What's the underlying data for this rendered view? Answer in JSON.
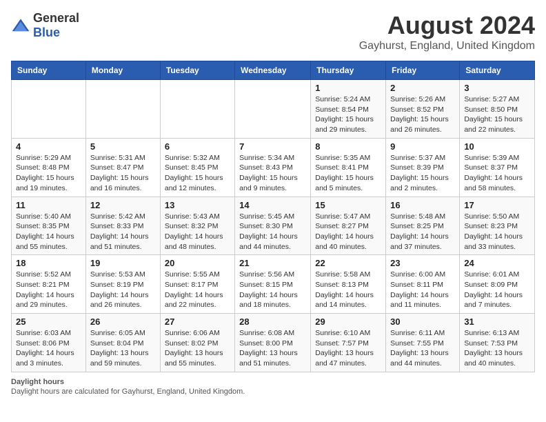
{
  "header": {
    "logo_general": "General",
    "logo_blue": "Blue",
    "title": "August 2024",
    "subtitle": "Gayhurst, England, United Kingdom"
  },
  "columns": [
    "Sunday",
    "Monday",
    "Tuesday",
    "Wednesday",
    "Thursday",
    "Friday",
    "Saturday"
  ],
  "weeks": [
    [
      {
        "day": "",
        "info": ""
      },
      {
        "day": "",
        "info": ""
      },
      {
        "day": "",
        "info": ""
      },
      {
        "day": "",
        "info": ""
      },
      {
        "day": "1",
        "info": "Sunrise: 5:24 AM\nSunset: 8:54 PM\nDaylight: 15 hours and 29 minutes."
      },
      {
        "day": "2",
        "info": "Sunrise: 5:26 AM\nSunset: 8:52 PM\nDaylight: 15 hours and 26 minutes."
      },
      {
        "day": "3",
        "info": "Sunrise: 5:27 AM\nSunset: 8:50 PM\nDaylight: 15 hours and 22 minutes."
      }
    ],
    [
      {
        "day": "4",
        "info": "Sunrise: 5:29 AM\nSunset: 8:48 PM\nDaylight: 15 hours and 19 minutes."
      },
      {
        "day": "5",
        "info": "Sunrise: 5:31 AM\nSunset: 8:47 PM\nDaylight: 15 hours and 16 minutes."
      },
      {
        "day": "6",
        "info": "Sunrise: 5:32 AM\nSunset: 8:45 PM\nDaylight: 15 hours and 12 minutes."
      },
      {
        "day": "7",
        "info": "Sunrise: 5:34 AM\nSunset: 8:43 PM\nDaylight: 15 hours and 9 minutes."
      },
      {
        "day": "8",
        "info": "Sunrise: 5:35 AM\nSunset: 8:41 PM\nDaylight: 15 hours and 5 minutes."
      },
      {
        "day": "9",
        "info": "Sunrise: 5:37 AM\nSunset: 8:39 PM\nDaylight: 15 hours and 2 minutes."
      },
      {
        "day": "10",
        "info": "Sunrise: 5:39 AM\nSunset: 8:37 PM\nDaylight: 14 hours and 58 minutes."
      }
    ],
    [
      {
        "day": "11",
        "info": "Sunrise: 5:40 AM\nSunset: 8:35 PM\nDaylight: 14 hours and 55 minutes."
      },
      {
        "day": "12",
        "info": "Sunrise: 5:42 AM\nSunset: 8:33 PM\nDaylight: 14 hours and 51 minutes."
      },
      {
        "day": "13",
        "info": "Sunrise: 5:43 AM\nSunset: 8:32 PM\nDaylight: 14 hours and 48 minutes."
      },
      {
        "day": "14",
        "info": "Sunrise: 5:45 AM\nSunset: 8:30 PM\nDaylight: 14 hours and 44 minutes."
      },
      {
        "day": "15",
        "info": "Sunrise: 5:47 AM\nSunset: 8:27 PM\nDaylight: 14 hours and 40 minutes."
      },
      {
        "day": "16",
        "info": "Sunrise: 5:48 AM\nSunset: 8:25 PM\nDaylight: 14 hours and 37 minutes."
      },
      {
        "day": "17",
        "info": "Sunrise: 5:50 AM\nSunset: 8:23 PM\nDaylight: 14 hours and 33 minutes."
      }
    ],
    [
      {
        "day": "18",
        "info": "Sunrise: 5:52 AM\nSunset: 8:21 PM\nDaylight: 14 hours and 29 minutes."
      },
      {
        "day": "19",
        "info": "Sunrise: 5:53 AM\nSunset: 8:19 PM\nDaylight: 14 hours and 26 minutes."
      },
      {
        "day": "20",
        "info": "Sunrise: 5:55 AM\nSunset: 8:17 PM\nDaylight: 14 hours and 22 minutes."
      },
      {
        "day": "21",
        "info": "Sunrise: 5:56 AM\nSunset: 8:15 PM\nDaylight: 14 hours and 18 minutes."
      },
      {
        "day": "22",
        "info": "Sunrise: 5:58 AM\nSunset: 8:13 PM\nDaylight: 14 hours and 14 minutes."
      },
      {
        "day": "23",
        "info": "Sunrise: 6:00 AM\nSunset: 8:11 PM\nDaylight: 14 hours and 11 minutes."
      },
      {
        "day": "24",
        "info": "Sunrise: 6:01 AM\nSunset: 8:09 PM\nDaylight: 14 hours and 7 minutes."
      }
    ],
    [
      {
        "day": "25",
        "info": "Sunrise: 6:03 AM\nSunset: 8:06 PM\nDaylight: 14 hours and 3 minutes."
      },
      {
        "day": "26",
        "info": "Sunrise: 6:05 AM\nSunset: 8:04 PM\nDaylight: 13 hours and 59 minutes."
      },
      {
        "day": "27",
        "info": "Sunrise: 6:06 AM\nSunset: 8:02 PM\nDaylight: 13 hours and 55 minutes."
      },
      {
        "day": "28",
        "info": "Sunrise: 6:08 AM\nSunset: 8:00 PM\nDaylight: 13 hours and 51 minutes."
      },
      {
        "day": "29",
        "info": "Sunrise: 6:10 AM\nSunset: 7:57 PM\nDaylight: 13 hours and 47 minutes."
      },
      {
        "day": "30",
        "info": "Sunrise: 6:11 AM\nSunset: 7:55 PM\nDaylight: 13 hours and 44 minutes."
      },
      {
        "day": "31",
        "info": "Sunrise: 6:13 AM\nSunset: 7:53 PM\nDaylight: 13 hours and 40 minutes."
      }
    ]
  ],
  "footer": {
    "title": "Daylight hours",
    "text": "Daylight hours are calculated for Gayhurst, England, United Kingdom."
  }
}
